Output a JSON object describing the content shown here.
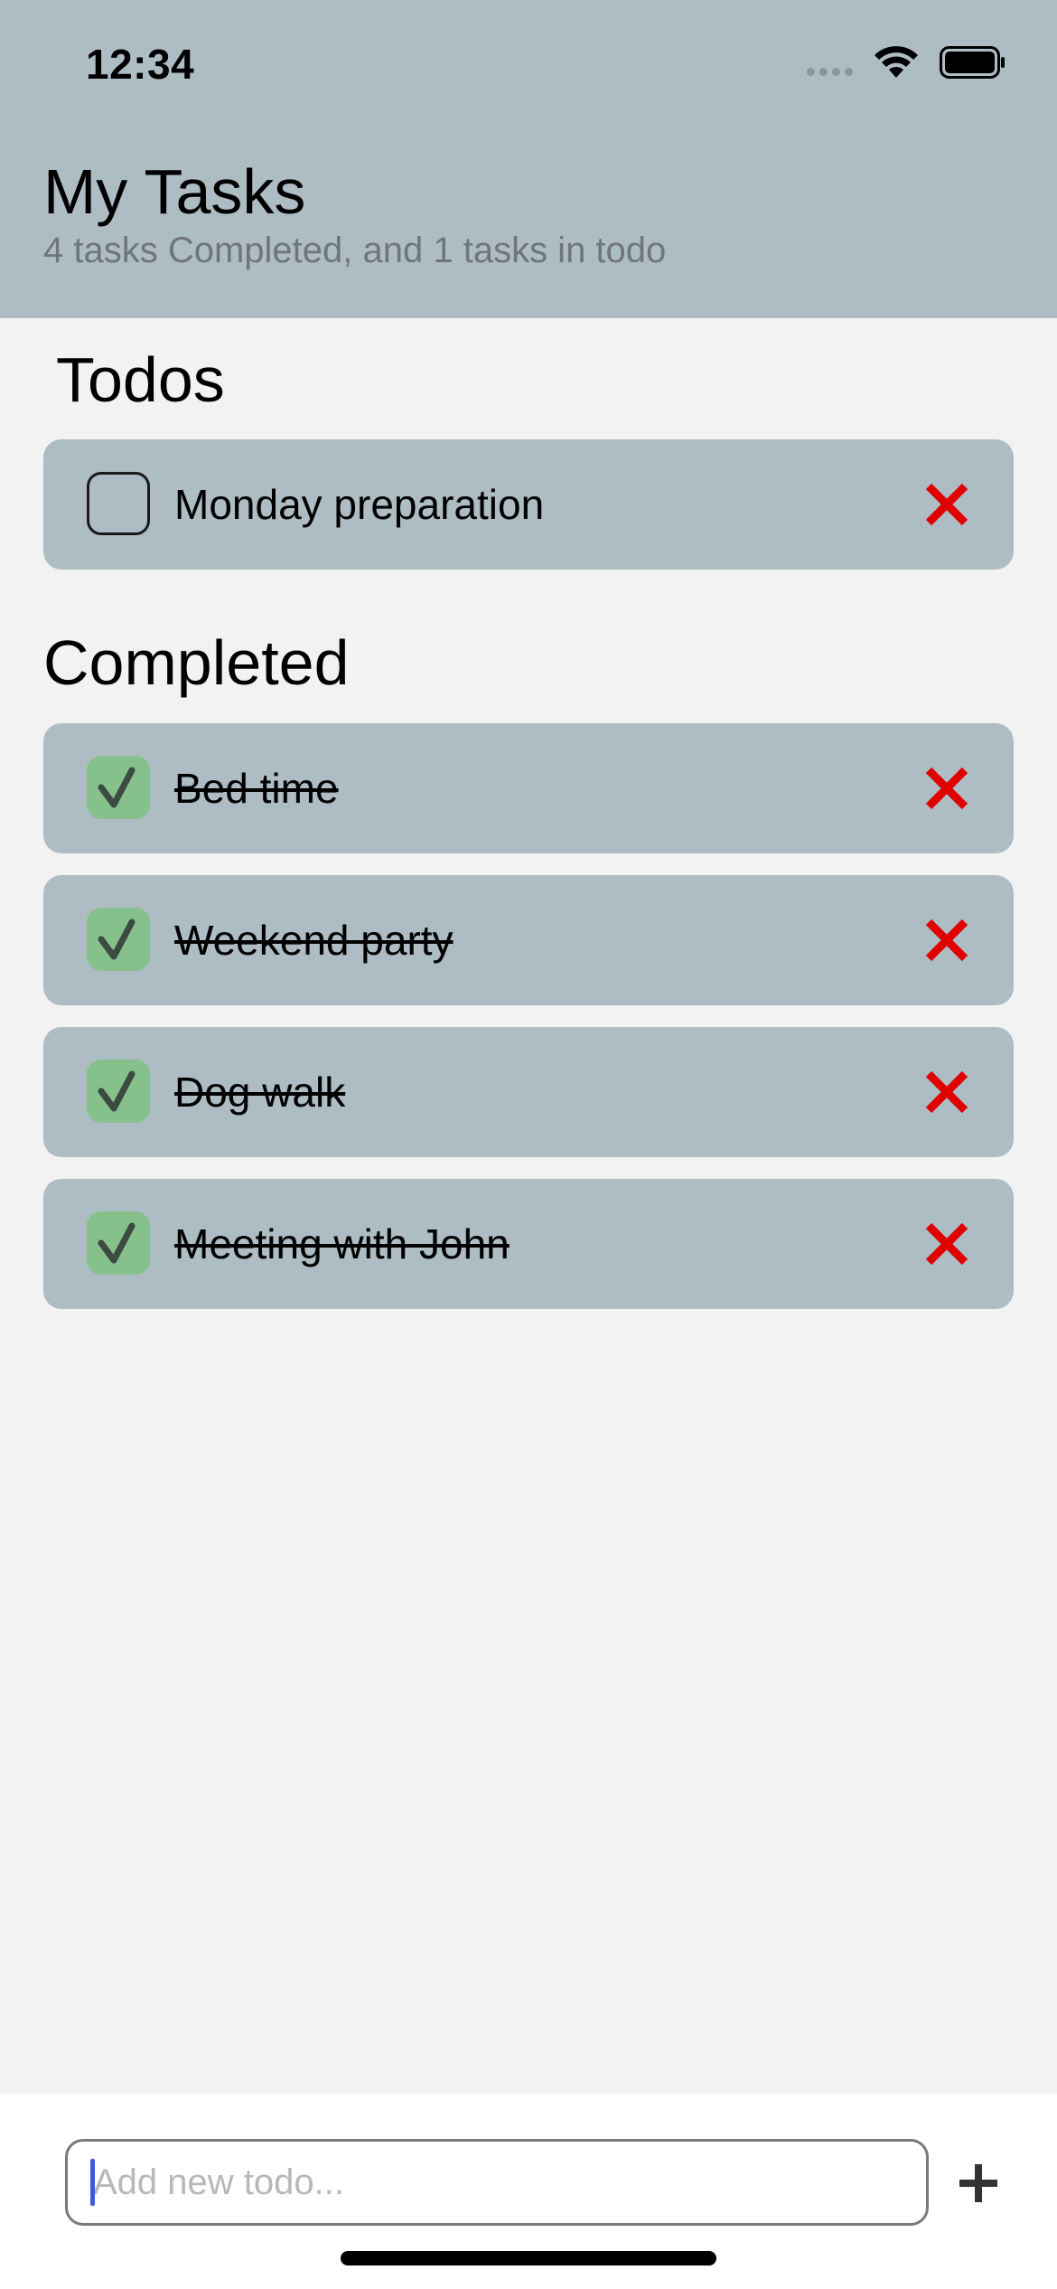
{
  "status_bar": {
    "time": "12:34"
  },
  "header": {
    "title": "My Tasks",
    "subtitle": "4 tasks Completed, and 1 tasks in todo"
  },
  "sections": {
    "todos_title": "Todos",
    "completed_title": "Completed"
  },
  "todos": [
    {
      "label": "Monday preparation",
      "done": false
    }
  ],
  "completed": [
    {
      "label": "Bed time",
      "done": true
    },
    {
      "label": "Weekend party",
      "done": true
    },
    {
      "label": "Dog walk",
      "done": true
    },
    {
      "label": "Meeting with John",
      "done": true
    }
  ],
  "new_todo": {
    "placeholder": "Add new todo...",
    "value": ""
  },
  "icons": {
    "delete": "close-icon",
    "check": "checkmark-icon",
    "add": "plus-icon"
  },
  "colors": {
    "header_bg": "#aebcc4",
    "card_bg": "#aebcc4",
    "page_bg": "#f2f2f2",
    "check_bg": "#86c18c",
    "delete_red": "#e00000",
    "subtitle": "#6f767a"
  }
}
